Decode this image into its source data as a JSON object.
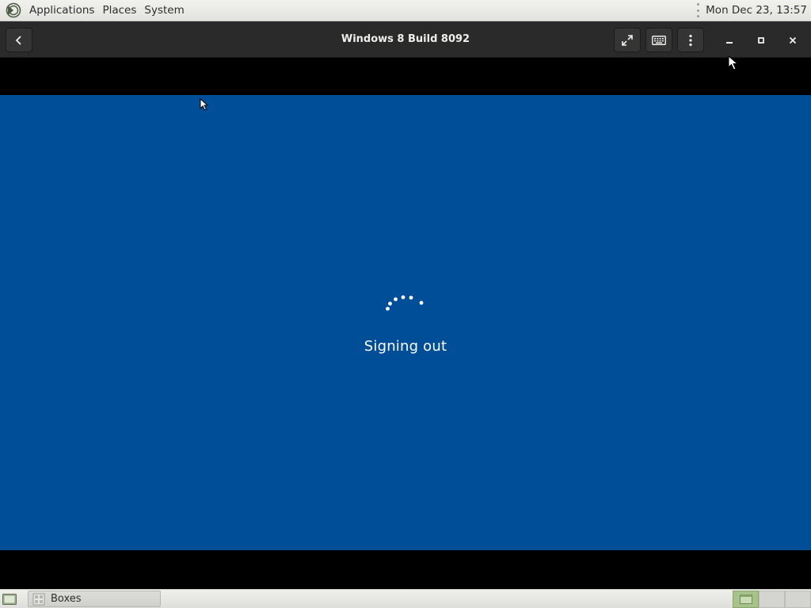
{
  "top_panel": {
    "menus": [
      "Applications",
      "Places",
      "System"
    ],
    "clock": "Mon Dec 23, 13:57"
  },
  "window": {
    "title": "Windows 8 Build 8092",
    "buttons": [
      "back-icon",
      "fullscreen-icon",
      "keyboard-icon",
      "menu-icon",
      "minimize-icon",
      "maximize-icon",
      "close-icon"
    ]
  },
  "guest": {
    "background_color": "#004e98",
    "status_text": "Signing out"
  },
  "taskbar": {
    "tasks": [
      {
        "label": "Boxes"
      }
    ],
    "workspace_count": 3,
    "active_workspace": 1
  }
}
